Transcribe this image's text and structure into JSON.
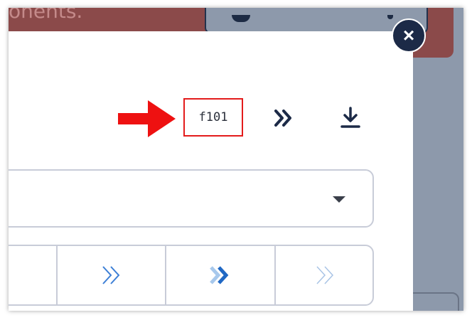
{
  "background": {
    "banner_text": "onents.",
    "banner_color": "#8b4a4a",
    "backdrop_color": "#8d99ab"
  },
  "modal": {
    "close_label": "×",
    "code_tag": "f101",
    "annotation_color": "#e31b1b",
    "icons": {
      "skip": "double-chevron-right-icon",
      "download": "download-icon",
      "dropdown": "caret-down-icon"
    },
    "dropdown": {
      "selected_value": ""
    },
    "segments": [
      {
        "icon": "segment-blank",
        "style": "none"
      },
      {
        "icon": "double-chevron-right-icon",
        "style": "outline-blue"
      },
      {
        "icon": "double-chevron-right-icon",
        "style": "bold-two-tone"
      },
      {
        "icon": "double-chevron-right-icon",
        "style": "outline-light"
      }
    ]
  }
}
